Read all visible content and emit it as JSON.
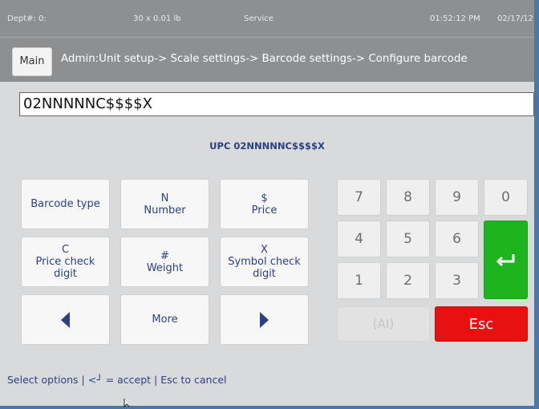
{
  "status": {
    "dept": "Dept#: 0:",
    "weight": "30 x 0.01 lb",
    "mode": "Service",
    "time": "01:52:12 PM",
    "date": "02/17/12"
  },
  "header": {
    "main_label": "Main",
    "breadcrumb": "Admin:Unit setup-> Scale settings-> Barcode settings-> Configure barcode"
  },
  "entry": {
    "value": "02NNNNNC$$$$X"
  },
  "preview": "UPC 02NNNNNC$$$$X",
  "options": {
    "barcode_type": "Barcode type",
    "number_code": "N",
    "number_label": "Number",
    "price_code": "$",
    "price_label": "Price",
    "price_check_code": "C",
    "price_check_label1": "Price check",
    "price_check_label2": "digit",
    "weight_code": "#",
    "weight_label": "Weight",
    "symbol_check_code": "X",
    "symbol_check_label1": "Symbol check",
    "symbol_check_label2": "digit",
    "more": "More"
  },
  "keypad": {
    "k7": "7",
    "k8": "8",
    "k9": "9",
    "k0": "0",
    "k4": "4",
    "k5": "5",
    "k6": "6",
    "k1": "1",
    "k2": "2",
    "k3": "3",
    "ai": "(AI)",
    "esc": "Esc"
  },
  "footer": "Select options | <┘ = accept | Esc to cancel",
  "colors": {
    "accent_text": "#2b3f86",
    "enter_green": "#1db41d",
    "esc_red": "#e81010",
    "bar_gray": "#8e8f91"
  }
}
